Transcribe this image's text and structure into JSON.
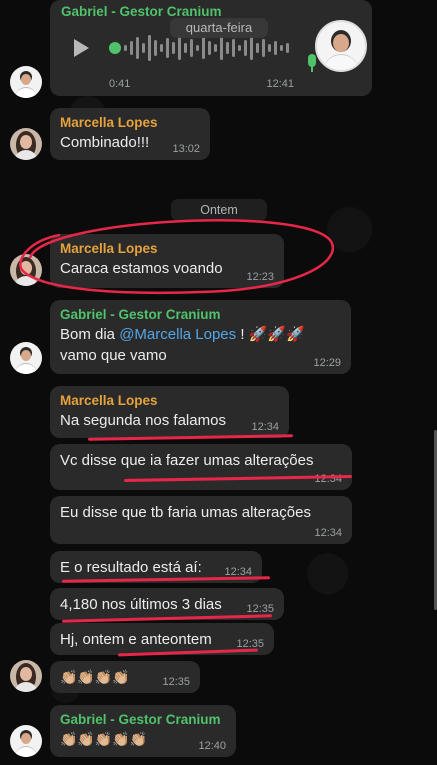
{
  "voice_message": {
    "sender": "Gabriel - Gestor Cranium",
    "duration": "0:41",
    "time": "12:41"
  },
  "day_label": "quarta-feira",
  "date_separator": "Ontem",
  "messages": [
    {
      "sender": "Marcella Lopes",
      "text": "Combinado!!!",
      "time": "13:02"
    },
    {
      "sender": "Marcella Lopes",
      "text": "Caraca estamos voando",
      "time": "12:23"
    },
    {
      "sender": "Gabriel - Gestor Cranium",
      "text_prefix": "Bom dia ",
      "mention": "@Marcella Lopes",
      "text_suffix": " ! 🚀🚀🚀",
      "text_line2": "vamo que vamo",
      "time": "12:29"
    },
    {
      "sender": "Marcella Lopes",
      "text": "Na segunda nos falamos",
      "time": "12:34"
    },
    {
      "text": "Vc disse que ia fazer umas alterações",
      "time": "12:34"
    },
    {
      "text": "Eu disse que tb faria umas alterações",
      "time": "12:34"
    },
    {
      "text": "E o resultado está aí:",
      "time": "12:34"
    },
    {
      "text": "4,180 nos últimos 3 dias",
      "time": "12:35"
    },
    {
      "text": "Hj, ontem e anteontem",
      "time": "12:35"
    },
    {
      "text": "👏🏼👏🏼👏🏼👏🏼",
      "time": "12:35"
    },
    {
      "sender": "Gabriel - Gestor Cranium",
      "text": "👏🏼👏🏼👏🏼👏🏼👏🏼",
      "time": "12:40"
    }
  ],
  "colors": {
    "bubble": "#2a2a2a",
    "sender_gabriel": "#4fc26b",
    "sender_marcella": "#e6a23c",
    "mention": "#53a6e8",
    "annotation_red": "#e8264a"
  }
}
